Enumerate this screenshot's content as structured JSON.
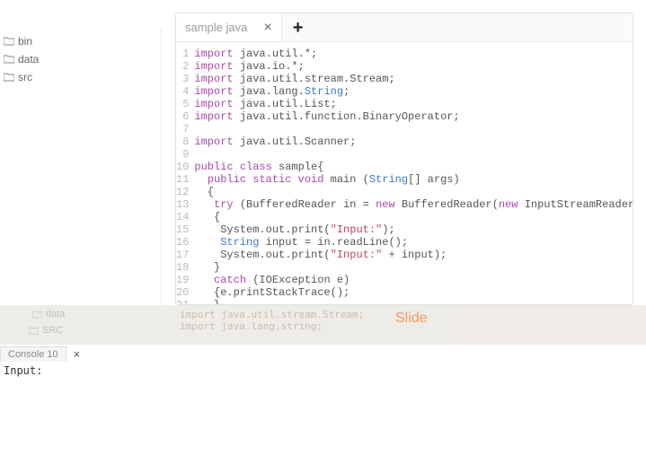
{
  "sidebar": {
    "folders": [
      {
        "label": "bin"
      },
      {
        "label": "data"
      },
      {
        "label": "src"
      }
    ]
  },
  "editor": {
    "tab": {
      "label": "sample java",
      "close": "×",
      "add": "+"
    },
    "lines": [
      {
        "n": "1",
        "tokens": [
          [
            "kw",
            "import"
          ],
          [
            "plain",
            " java.util.*;"
          ]
        ]
      },
      {
        "n": "2",
        "tokens": [
          [
            "kw",
            "import"
          ],
          [
            "plain",
            " java.io.*;"
          ]
        ]
      },
      {
        "n": "3",
        "tokens": [
          [
            "kw",
            "import"
          ],
          [
            "plain",
            " java.util.stream.Stream;"
          ]
        ]
      },
      {
        "n": "4",
        "tokens": [
          [
            "kw",
            "import"
          ],
          [
            "plain",
            " java.lang."
          ],
          [
            "type",
            "String"
          ],
          [
            "plain",
            ";"
          ]
        ]
      },
      {
        "n": "5",
        "tokens": [
          [
            "kw",
            "import"
          ],
          [
            "plain",
            " java.util.List;"
          ]
        ]
      },
      {
        "n": "6",
        "tokens": [
          [
            "kw",
            "import"
          ],
          [
            "plain",
            " java.util.function.BinaryOperator;"
          ]
        ]
      },
      {
        "n": "7",
        "tokens": []
      },
      {
        "n": "8",
        "tokens": [
          [
            "kw",
            "import"
          ],
          [
            "plain",
            " java.util.Scanner;"
          ]
        ]
      },
      {
        "n": "9",
        "tokens": []
      },
      {
        "n": "10",
        "tokens": [
          [
            "kw",
            "public class"
          ],
          [
            "plain",
            " sample{"
          ]
        ]
      },
      {
        "n": "11",
        "tokens": [
          [
            "plain",
            "  "
          ],
          [
            "kw",
            "public static void"
          ],
          [
            "plain",
            " main ("
          ],
          [
            "type",
            "String"
          ],
          [
            "plain",
            "[] args)"
          ]
        ]
      },
      {
        "n": "12",
        "tokens": [
          [
            "plain",
            "  {"
          ]
        ]
      },
      {
        "n": "13",
        "tokens": [
          [
            "plain",
            "   "
          ],
          [
            "kw",
            "try"
          ],
          [
            "plain",
            " (BufferedReader in = "
          ],
          [
            "kw",
            "new"
          ],
          [
            "plain",
            " BufferedReader("
          ],
          [
            "kw",
            "new"
          ],
          [
            "plain",
            " InputStreamReader(System.in)))"
          ]
        ]
      },
      {
        "n": "14",
        "tokens": [
          [
            "plain",
            "   {"
          ]
        ]
      },
      {
        "n": "15",
        "tokens": [
          [
            "plain",
            "    System.out.print("
          ],
          [
            "str",
            "\"Input:\""
          ],
          [
            "plain",
            ");"
          ]
        ]
      },
      {
        "n": "16",
        "tokens": [
          [
            "plain",
            "    "
          ],
          [
            "type",
            "String"
          ],
          [
            "plain",
            " input = in.readLine();"
          ]
        ]
      },
      {
        "n": "17",
        "tokens": [
          [
            "plain",
            "    System.out.print("
          ],
          [
            "str",
            "\"Input:\""
          ],
          [
            "plain",
            " + input);"
          ]
        ]
      },
      {
        "n": "18",
        "tokens": [
          [
            "plain",
            "   }"
          ]
        ]
      },
      {
        "n": "19",
        "tokens": [
          [
            "plain",
            "   "
          ],
          [
            "kw",
            "catch"
          ],
          [
            "plain",
            " (IOException e)"
          ]
        ]
      },
      {
        "n": "20",
        "tokens": [
          [
            "plain",
            "   {e.printStackTrace();"
          ]
        ]
      },
      {
        "n": "21",
        "tokens": [
          [
            "plain",
            "   }"
          ]
        ]
      }
    ]
  },
  "overlay": {
    "folder1": "data",
    "folder2": "SRC",
    "code": [
      "import java.util.stream.Stream;",
      "import java.lang.string;"
    ],
    "slide": "Slide"
  },
  "console": {
    "tab": "Console 10",
    "close": "×",
    "output": "Input:"
  }
}
